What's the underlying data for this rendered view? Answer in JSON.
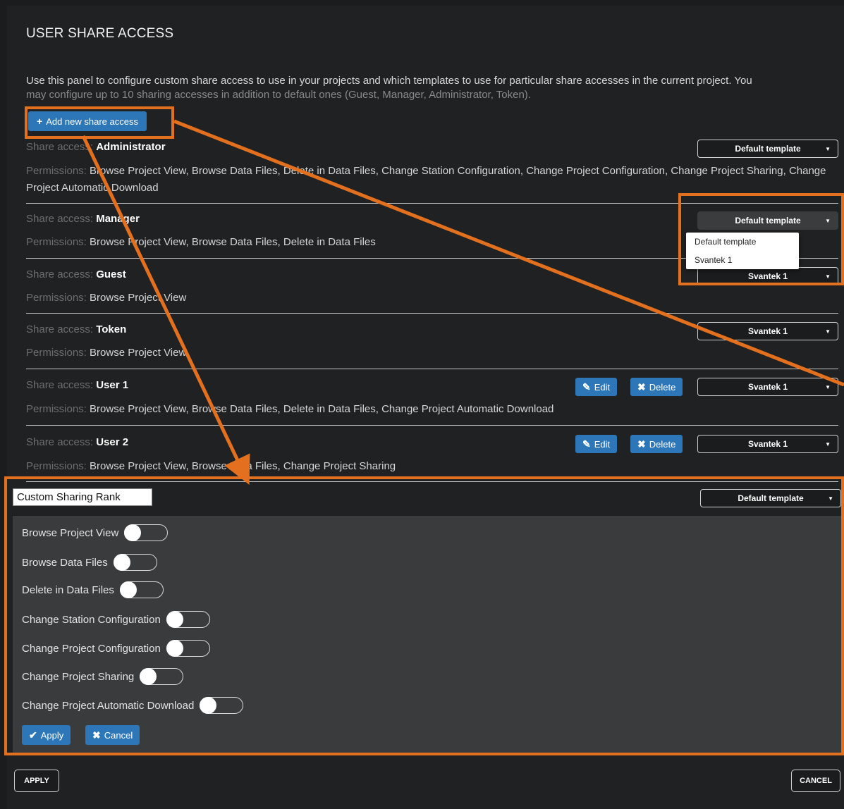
{
  "dialog": {
    "title": "USER SHARE ACCESS",
    "description_main": "Use this panel to configure custom share access to use in your projects and which templates to use for particular share accesses in the current project. You",
    "description_cont": "may configure up to 10 sharing accesses in addition to default ones (Guest, Manager, Administrator, Token).",
    "add_button_label": "Add new share access",
    "share_access_prefix": "Share access:",
    "permissions_prefix": "Permissions:",
    "edit_label": "Edit",
    "delete_label": "Delete"
  },
  "rows": [
    {
      "name": "Administrator",
      "permissions": "Browse Project View, Browse Data Files, Delete in Data Files, Change Station Configuration, Change Project Configuration, Change Project Sharing, Change Project Automatic Download",
      "template": "Default template"
    },
    {
      "name": "Manager",
      "permissions": "Browse Project View, Browse Data Files, Delete in Data Files",
      "template": "Default template"
    },
    {
      "name": "Guest",
      "permissions": "Browse Project View",
      "template": "Svantek 1"
    },
    {
      "name": "Token",
      "permissions": "Browse Project View",
      "template": "Svantek 1"
    },
    {
      "name": "User 1",
      "permissions": "Browse Project View, Browse Data Files, Delete in Data Files, Change Project Automatic Download",
      "template": "Svantek 1"
    },
    {
      "name": "User 2",
      "permissions": "Browse Project View, Browse Data Files, Change Project Sharing",
      "template": "Svantek 1"
    }
  ],
  "dropdown_options": [
    "Default template",
    "Svantek 1"
  ],
  "custom": {
    "name_value": "Custom Sharing Rank",
    "template": "Default template",
    "toggles": [
      {
        "label": "Browse Project View",
        "on": false
      },
      {
        "label": "Browse Data Files",
        "on": false
      },
      {
        "label": "Delete in Data Files",
        "on": false
      },
      {
        "label": "Change Station Configuration",
        "on": false
      },
      {
        "label": "Change Project Configuration",
        "on": false
      },
      {
        "label": "Change Project Sharing",
        "on": false
      },
      {
        "label": "Change Project Automatic Download",
        "on": false
      }
    ],
    "apply_label": "Apply",
    "cancel_label": "Cancel"
  },
  "footer": {
    "apply_label": "APPLY",
    "cancel_label": "CANCEL"
  },
  "colors": {
    "accent_blue": "#2d76b8",
    "highlight_orange": "#e2701e",
    "background": "#202122"
  },
  "icons": {
    "add": "plus-icon",
    "edit": "pencil-icon",
    "delete": "x-icon",
    "apply": "check-icon",
    "caret": "caret-down-icon"
  }
}
